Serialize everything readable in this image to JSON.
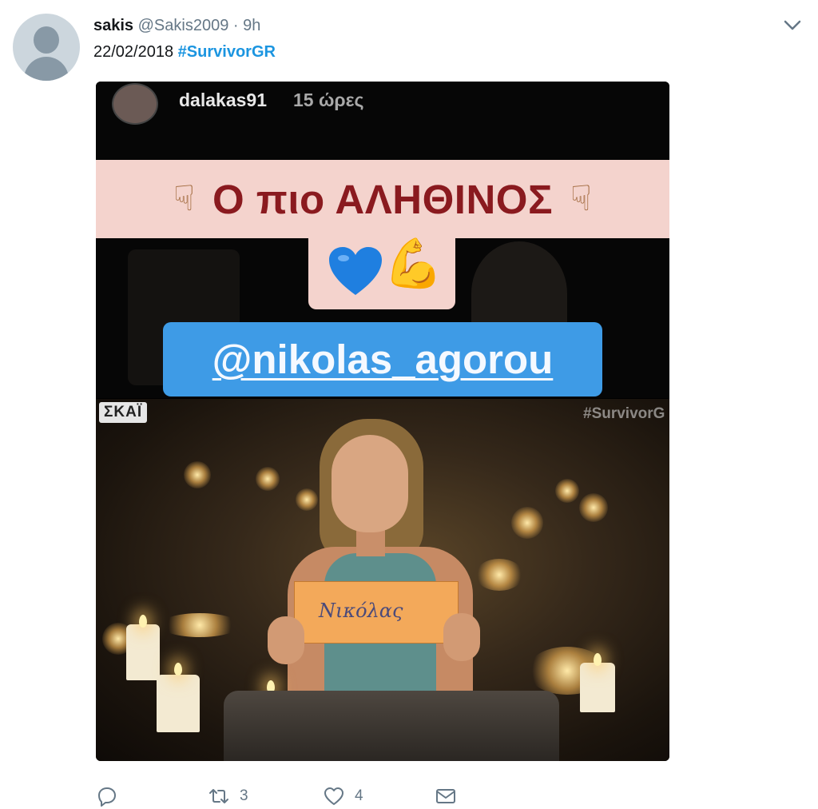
{
  "tweet": {
    "display_name": "sakis",
    "handle": "@Sakis2009",
    "separator": "·",
    "time": "9h",
    "date_text": "22/02/2018",
    "hashtag": "#SurvivorGR"
  },
  "story": {
    "username": "dalakas91",
    "time": "15 ώρες",
    "headline": "Ο πιο ΑΛΗΘΙΝΟΣ",
    "mention": "@nikolas_agorou"
  },
  "scene": {
    "channel": "ΣΚΑΪ",
    "watermark": "#SurvivorG",
    "sign_text": "Νικόλας"
  },
  "actions": {
    "reply_count": "",
    "retweet_count": "3",
    "like_count": "4"
  },
  "colors": {
    "hashtag": "#1b95e0",
    "meta": "#657786",
    "pink_band": "#f4d3cd",
    "headline": "#8a1a1f",
    "mention_pill": "#3e9be6"
  },
  "icons": [
    "avatar-default",
    "chevron-down-icon",
    "pointing-down-emoji",
    "blue-heart-emoji",
    "flexed-biceps-emoji",
    "reply-icon",
    "retweet-icon",
    "like-icon",
    "direct-message-icon"
  ]
}
